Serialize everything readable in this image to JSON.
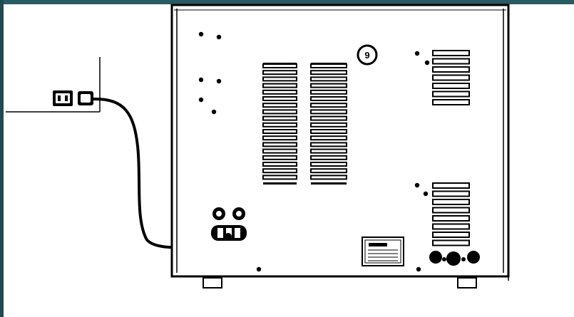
{
  "frame": {
    "border_color": "#1f4a52",
    "accent_color": "#2f6e72",
    "line_color": "#000000",
    "background": "#ffffff"
  },
  "diagram": {
    "callout_label": "9",
    "icons": [
      "wall-outlet-icon",
      "power-plug-icon",
      "power-inlet-icon",
      "fuse-holder-icon",
      "ventilation-grille",
      "card-slot",
      "rear-connector-icon",
      "label-plate"
    ]
  }
}
